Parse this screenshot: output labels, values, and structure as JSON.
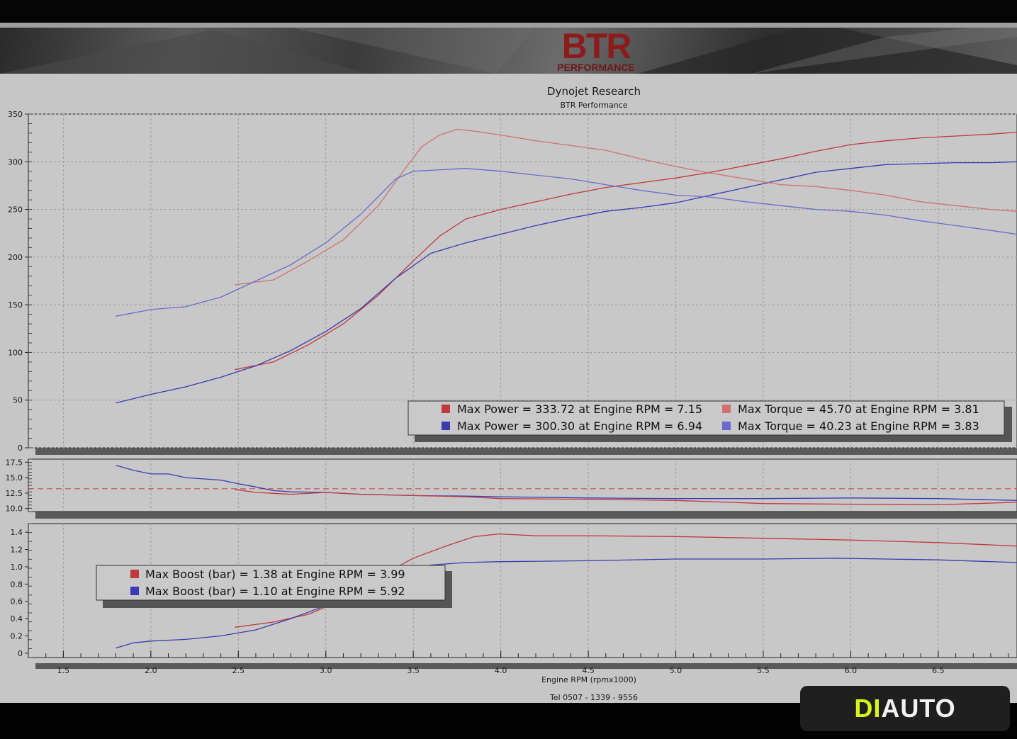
{
  "header": {
    "logo_main": "BTR",
    "logo_sub": "PERFORMANCE",
    "title": "Dynojet Research",
    "subtitle": "BTR Performance"
  },
  "footer": {
    "tel": "Tel  0507 - 1339 - 9556"
  },
  "watermark": {
    "part_a": "DI",
    "part_b": "AUTO",
    "part_a_color": "#d8f51c"
  },
  "colors": {
    "plot_bg": "#c6c6c6",
    "power_red": "#c0393b",
    "power_blue": "#3a3ab3",
    "torque_red": "#d07070",
    "torque_blue": "#6a6ad0",
    "afr_reference": "#c05050"
  },
  "chart_data": [
    {
      "type": "line",
      "panel": "power_torque",
      "xlim": [
        1.3,
        6.95
      ],
      "ylim": [
        0,
        350
      ],
      "y_ticks": [
        "0",
        "50",
        "100",
        "150",
        "200",
        "250",
        "300",
        "350"
      ],
      "grid": true,
      "legend_position": "bottom-right",
      "legend": [
        {
          "label": "Max Power = 333.72 at Engine RPM = 7.15",
          "color": "#c0393b"
        },
        {
          "label": "Max Torque = 45.70 at Engine RPM = 3.81",
          "color": "#d07070"
        },
        {
          "label": "Max Power = 300.30 at Engine RPM = 6.94",
          "color": "#3a3ab3"
        },
        {
          "label": "Max Torque = 40.23 at Engine RPM = 3.83",
          "color": "#6a6ad0"
        }
      ],
      "series": [
        {
          "color": "#c0393b",
          "x": [
            2.48,
            2.7,
            2.9,
            3.1,
            3.3,
            3.5,
            3.65,
            3.8,
            4.0,
            4.2,
            4.4,
            4.6,
            4.8,
            5.0,
            5.2,
            5.4,
            5.6,
            5.8,
            6.0,
            6.2,
            6.4,
            6.6,
            6.8,
            6.95
          ],
          "y": [
            82,
            90,
            108,
            130,
            160,
            196,
            222,
            240,
            250,
            258,
            266,
            273,
            278,
            283,
            289,
            296,
            303,
            311,
            318,
            322,
            325,
            327,
            329,
            331
          ]
        },
        {
          "color": "#3a3ab3",
          "x": [
            1.8,
            2.0,
            2.2,
            2.4,
            2.6,
            2.8,
            3.0,
            3.2,
            3.4,
            3.6,
            3.8,
            4.0,
            4.2,
            4.4,
            4.6,
            4.8,
            5.0,
            5.2,
            5.4,
            5.6,
            5.8,
            6.0,
            6.2,
            6.4,
            6.6,
            6.8,
            6.95
          ],
          "y": [
            47,
            56,
            64,
            74,
            86,
            102,
            122,
            146,
            178,
            204,
            215,
            224,
            233,
            241,
            248,
            252,
            257,
            265,
            273,
            281,
            289,
            293,
            297,
            298,
            299,
            299,
            300
          ]
        },
        {
          "color": "#d07070",
          "x": [
            2.48,
            2.7,
            2.9,
            3.1,
            3.3,
            3.45,
            3.55,
            3.65,
            3.75,
            3.85,
            4.0,
            4.2,
            4.4,
            4.6,
            4.8,
            5.0,
            5.2,
            5.4,
            5.6,
            5.8,
            6.0,
            6.2,
            6.4,
            6.6,
            6.8,
            6.95
          ],
          "y": [
            171,
            176,
            196,
            218,
            254,
            292,
            316,
            328,
            334,
            332,
            328,
            322,
            317,
            312,
            303,
            295,
            288,
            282,
            276,
            274,
            270,
            265,
            258,
            254,
            250,
            248
          ]
        },
        {
          "color": "#6a6ad0",
          "x": [
            1.8,
            2.0,
            2.2,
            2.4,
            2.6,
            2.8,
            3.0,
            3.2,
            3.4,
            3.5,
            3.6,
            3.8,
            4.0,
            4.2,
            4.4,
            4.6,
            4.8,
            5.0,
            5.2,
            5.4,
            5.6,
            5.8,
            6.0,
            6.2,
            6.4,
            6.6,
            6.8,
            6.95
          ],
          "y": [
            138,
            145,
            148,
            158,
            175,
            192,
            215,
            245,
            282,
            290,
            291,
            293,
            290,
            286,
            282,
            276,
            270,
            265,
            263,
            258,
            254,
            250,
            248,
            244,
            238,
            233,
            228,
            224
          ]
        }
      ]
    },
    {
      "type": "line",
      "panel": "afr",
      "xlim": [
        1.3,
        6.95
      ],
      "ylim": [
        9.5,
        18.0
      ],
      "y_ticks": [
        "10.0",
        "12.5",
        "15.0",
        "17.5"
      ],
      "reference_line": 13.2,
      "series": [
        {
          "color": "#3a3ab3",
          "x": [
            1.8,
            1.9,
            2.0,
            2.1,
            2.2,
            2.3,
            2.4,
            2.5,
            2.6,
            2.7,
            2.8,
            3.0,
            3.2,
            3.5,
            3.8,
            4.0,
            4.5,
            5.0,
            5.5,
            6.0,
            6.5,
            6.95
          ],
          "y": [
            17.0,
            16.2,
            15.6,
            15.6,
            15.0,
            14.8,
            14.6,
            14.0,
            13.5,
            12.9,
            12.7,
            12.6,
            12.3,
            12.1,
            12.0,
            11.9,
            11.7,
            11.6,
            11.6,
            11.7,
            11.6,
            11.3
          ]
        },
        {
          "color": "#c0393b",
          "x": [
            2.48,
            2.6,
            2.8,
            3.0,
            3.2,
            3.5,
            3.8,
            4.0,
            4.5,
            5.0,
            5.3,
            5.5,
            6.0,
            6.5,
            6.95
          ],
          "y": [
            13.1,
            12.6,
            12.3,
            12.6,
            12.3,
            12.1,
            11.9,
            11.6,
            11.5,
            11.3,
            11.0,
            10.8,
            10.7,
            10.6,
            11.0
          ]
        }
      ]
    },
    {
      "type": "line",
      "panel": "boost",
      "xlim": [
        1.3,
        6.95
      ],
      "ylim": [
        -0.05,
        1.5
      ],
      "y_ticks": [
        "0",
        "0.2",
        "0.4",
        "0.6",
        "0.8",
        "1.0",
        "1.2",
        "1.4"
      ],
      "xlabel": "Engine RPM (rpmx1000)",
      "x_ticks": [
        "1.5",
        "2.0",
        "2.5",
        "3.0",
        "3.5",
        "4.0",
        "4.5",
        "5.0",
        "5.5",
        "6.0",
        "6.5"
      ],
      "legend_position": "top-left",
      "legend": [
        {
          "label": "Max Boost (bar) = 1.38 at Engine RPM = 3.99",
          "color": "#c0393b"
        },
        {
          "label": "Max Boost (bar) = 1.10 at Engine RPM = 5.92",
          "color": "#3a3ab3"
        }
      ],
      "series": [
        {
          "color": "#c0393b",
          "x": [
            2.48,
            2.7,
            2.9,
            3.1,
            3.3,
            3.5,
            3.7,
            3.85,
            3.99,
            4.2,
            4.5,
            5.0,
            5.5,
            6.0,
            6.5,
            6.95
          ],
          "y": [
            0.3,
            0.36,
            0.45,
            0.62,
            0.88,
            1.1,
            1.25,
            1.35,
            1.38,
            1.36,
            1.36,
            1.35,
            1.33,
            1.31,
            1.28,
            1.24
          ]
        },
        {
          "color": "#3a3ab3",
          "x": [
            1.8,
            1.9,
            2.0,
            2.2,
            2.4,
            2.6,
            2.8,
            3.0,
            3.2,
            3.4,
            3.6,
            3.8,
            4.0,
            4.5,
            5.0,
            5.5,
            5.92,
            6.2,
            6.5,
            6.95
          ],
          "y": [
            0.06,
            0.12,
            0.14,
            0.16,
            0.2,
            0.27,
            0.4,
            0.55,
            0.72,
            0.9,
            1.02,
            1.05,
            1.06,
            1.07,
            1.09,
            1.09,
            1.1,
            1.09,
            1.08,
            1.05
          ]
        }
      ]
    }
  ]
}
